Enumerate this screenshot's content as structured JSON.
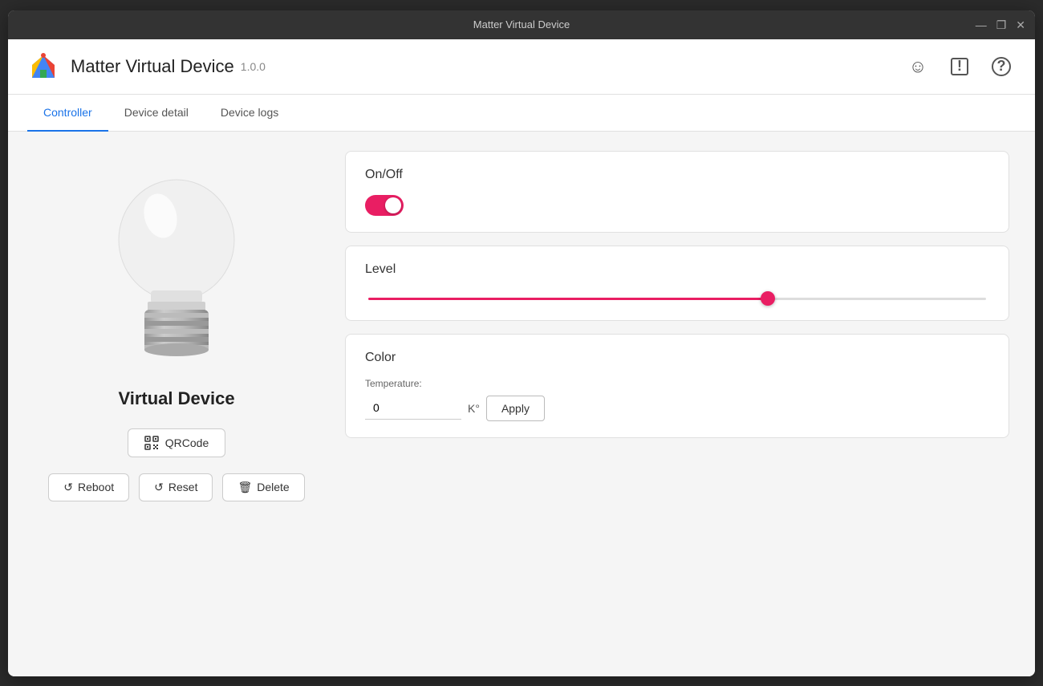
{
  "titleBar": {
    "title": "Matter Virtual Device",
    "controls": {
      "minimize": "—",
      "maximize": "❐",
      "close": "✕"
    }
  },
  "header": {
    "appName": "Matter Virtual Device",
    "version": "1.0.0",
    "icons": {
      "emoji": "☺",
      "alert": "⊡",
      "help": "?"
    }
  },
  "tabs": [
    {
      "id": "controller",
      "label": "Controller",
      "active": true
    },
    {
      "id": "device-detail",
      "label": "Device detail",
      "active": false
    },
    {
      "id": "device-logs",
      "label": "Device logs",
      "active": false
    }
  ],
  "leftPanel": {
    "deviceName": "Virtual Device",
    "qrcodeLabel": "QRCode",
    "buttons": [
      {
        "id": "reboot",
        "label": "Reboot",
        "icon": "↺"
      },
      {
        "id": "reset",
        "label": "Reset",
        "icon": "↺"
      },
      {
        "id": "delete",
        "label": "Delete",
        "icon": "🗑"
      }
    ]
  },
  "rightPanel": {
    "cards": [
      {
        "id": "on-off",
        "label": "On/Off",
        "type": "toggle",
        "toggled": true
      },
      {
        "id": "level",
        "label": "Level",
        "type": "slider",
        "value": 65
      },
      {
        "id": "color",
        "label": "Color",
        "type": "color",
        "tempLabel": "Temperature:",
        "tempValue": "0",
        "tempUnit": "K°",
        "applyLabel": "Apply"
      }
    ]
  }
}
